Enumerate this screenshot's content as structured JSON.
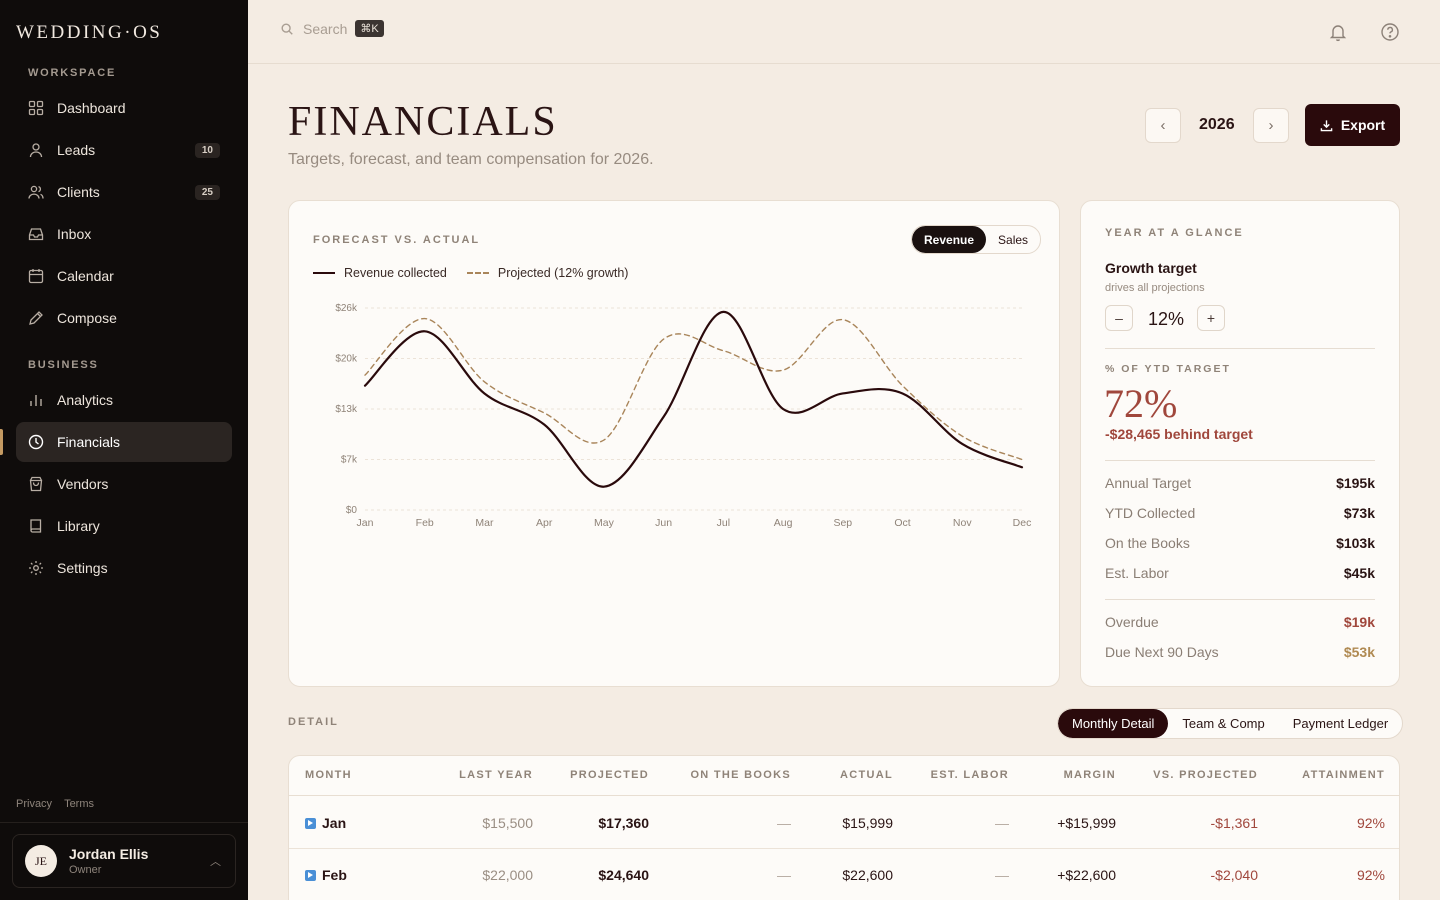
{
  "app": {
    "brand": "WEDDING·OS"
  },
  "sidebar": {
    "workspace_label": "WORKSPACE",
    "business_label": "BUSINESS",
    "items": [
      {
        "label": "Dashboard",
        "icon": "grid-icon"
      },
      {
        "label": "Leads",
        "icon": "user-icon",
        "badge": "10"
      },
      {
        "label": "Clients",
        "icon": "users-icon",
        "badge": "25"
      },
      {
        "label": "Inbox",
        "icon": "inbox-icon"
      },
      {
        "label": "Calendar",
        "icon": "calendar-icon"
      },
      {
        "label": "Compose",
        "icon": "pen-icon"
      },
      {
        "label": "Analytics",
        "icon": "bar-chart-icon"
      },
      {
        "label": "Financials",
        "icon": "clock-icon",
        "active": true
      },
      {
        "label": "Vendors",
        "icon": "bag-icon"
      },
      {
        "label": "Library",
        "icon": "book-icon"
      },
      {
        "label": "Settings",
        "icon": "gear-icon"
      }
    ],
    "footer": {
      "privacy": "Privacy",
      "terms": "Terms"
    },
    "user": {
      "initials": "JE",
      "name": "Jordan Ellis",
      "role": "Owner"
    }
  },
  "topbar": {
    "search_placeholder": "Search",
    "shortcut": "⌘K"
  },
  "header": {
    "title": "FINANCIALS",
    "subtitle": "Targets, forecast, and team compensation for 2026.",
    "year": "2026",
    "prev": "‹",
    "next": "›",
    "export_label": "Export"
  },
  "forecast": {
    "label": "FORECAST VS. ACTUAL",
    "toggle": [
      "Revenue",
      "Sales"
    ],
    "toggle_selected": "Revenue",
    "legend": {
      "actual": "Revenue collected",
      "projected": "Projected (12% growth)"
    }
  },
  "chart_data": {
    "type": "line",
    "categories": [
      "Jan",
      "Feb",
      "Mar",
      "Apr",
      "May",
      "Jun",
      "Jul",
      "Aug",
      "Sep",
      "Oct",
      "Nov",
      "Dec"
    ],
    "y_ticks": [
      "$0",
      "$7k",
      "$13k",
      "$20k",
      "$26k"
    ],
    "ylim": [
      0,
      26000
    ],
    "grid": true,
    "legend_position": "top-left",
    "series": [
      {
        "name": "Revenue collected",
        "style": "solid",
        "color": "#2a0a0c",
        "values": [
          16000,
          23000,
          15000,
          11000,
          3000,
          12000,
          25500,
          13000,
          15000,
          15000,
          8500,
          5500
        ]
      },
      {
        "name": "Projected (12% growth)",
        "style": "dashed",
        "color": "#a9855a",
        "values": [
          17360,
          24640,
          16500,
          12500,
          9000,
          22000,
          20500,
          18000,
          24500,
          16000,
          9500,
          6500
        ]
      }
    ]
  },
  "glance": {
    "label": "YEAR AT A GLANCE",
    "growth_title": "Growth target",
    "growth_sub": "drives all projections",
    "growth_value": "12%",
    "minus": "–",
    "plus": "+",
    "ytd_label": "% OF YTD TARGET",
    "ytd_value": "72%",
    "behind": "-$28,465 behind target",
    "rows": [
      {
        "label": "Annual Target",
        "value": "$195k"
      },
      {
        "label": "YTD Collected",
        "value": "$73k"
      },
      {
        "label": "On the Books",
        "value": "$103k"
      },
      {
        "label": "Est. Labor",
        "value": "$45k"
      }
    ],
    "overdue": {
      "label": "Overdue",
      "value": "$19k"
    },
    "due90": {
      "label": "Due Next 90 Days",
      "value": "$53k"
    }
  },
  "detail": {
    "label": "DETAIL",
    "tabs": [
      "Monthly Detail",
      "Team & Comp",
      "Payment Ledger"
    ],
    "tab_selected": "Monthly Detail",
    "columns": [
      "MONTH",
      "LAST YEAR",
      "PROJECTED",
      "ON THE BOOKS",
      "ACTUAL",
      "EST. LABOR",
      "MARGIN",
      "VS. PROJECTED",
      "ATTAINMENT"
    ],
    "rows": [
      {
        "month": "Jan",
        "last_year": "$15,500",
        "projected": "$17,360",
        "on_books": "—",
        "actual": "$15,999",
        "labor": "—",
        "margin": "+$15,999",
        "vs": "-$1,361",
        "attain": "92%"
      },
      {
        "month": "Feb",
        "last_year": "$22,000",
        "projected": "$24,640",
        "on_books": "—",
        "actual": "$22,600",
        "labor": "—",
        "margin": "+$22,600",
        "vs": "-$2,040",
        "attain": "92%"
      }
    ]
  },
  "colors": {
    "accent": "#2a0a0c",
    "negative": "#a0473c",
    "gold": "#b08a52",
    "sidebar": "#0f0c0b",
    "page": "#f4ece3"
  }
}
